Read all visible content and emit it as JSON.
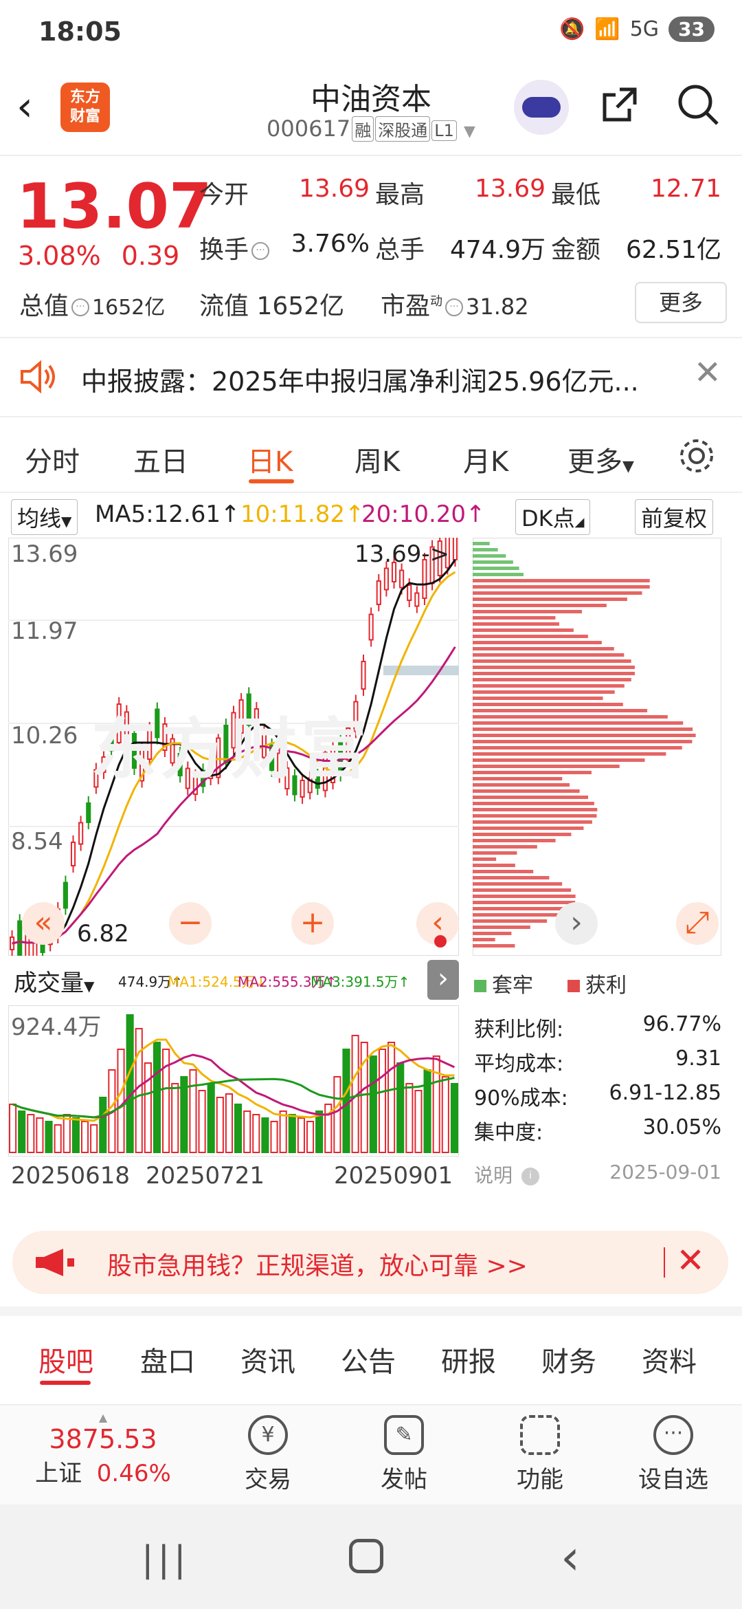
{
  "status": {
    "time": "18:05",
    "battery": "33",
    "signal": "5G"
  },
  "header": {
    "logo_line1": "东方",
    "logo_line2": "财富",
    "title": "中油资本",
    "code": "000617",
    "tags": [
      "融",
      "深股通",
      "L1"
    ]
  },
  "quote": {
    "price": "13.07",
    "pct": "3.08%",
    "change": "0.39",
    "open_label": "今开",
    "open": "13.69",
    "high_label": "最高",
    "high": "13.69",
    "low_label": "最低",
    "low": "12.71",
    "turnover_label": "换手",
    "turnover": "3.76%",
    "volume_label": "总手",
    "volume": "474.9万",
    "amount_label": "金额",
    "amount": "62.51亿",
    "mktcap_label": "总值",
    "mktcap": "1652亿",
    "float_label": "流值",
    "float": "1652亿",
    "pe_label": "市盈",
    "pe_sup": "动",
    "pe": "31.82",
    "more": "更多"
  },
  "notice": {
    "text": "中报披露：2025年中报归属净利润25.96亿元..."
  },
  "ktabs": [
    "分时",
    "五日",
    "日K",
    "周K",
    "月K",
    "更多"
  ],
  "ma": {
    "selector": "均线",
    "ma5": "MA5:12.61↑",
    "ma10": "10:11.82↑",
    "ma20": "20:10.20↑",
    "dk": "DK点",
    "adjust": "前复权"
  },
  "kchart": {
    "ylabels": [
      "13.69",
      "11.97",
      "10.26",
      "8.54",
      "6.82"
    ],
    "max_label": "13.69->",
    "min_label": "6.82",
    "watermark": "东方财富"
  },
  "volume": {
    "selector": "成交量",
    "vol": "474.9万↑",
    "ma1": "MA1:524.5万↓",
    "ma2": "MA2:555.3万↑",
    "ma3": "MA3:391.5万↑",
    "ylabel": "924.4万",
    "dates": [
      "20250618",
      "20250721",
      "20250901"
    ]
  },
  "chip": {
    "legend_trap": "套牢",
    "legend_profit": "获利",
    "stats": [
      {
        "label": "获利比例:",
        "value": "96.77%"
      },
      {
        "label": "平均成本:",
        "value": "9.31"
      },
      {
        "label": "90%成本:",
        "value": "6.91-12.85"
      },
      {
        "label": "集中度:",
        "value": "30.05%"
      }
    ],
    "explain": "说明",
    "date": "2025-09-01"
  },
  "ad": {
    "text": "股市急用钱？正规渠道，放心可靠 >>"
  },
  "btabs": [
    "股吧",
    "盘口",
    "资讯",
    "公告",
    "研报",
    "财务",
    "资料"
  ],
  "footer": {
    "index_value": "3875.53",
    "index_name": "上证",
    "index_pct": "0.46%",
    "items": [
      "交易",
      "发帖",
      "功能",
      "设自选"
    ]
  },
  "colors": {
    "up": "#e3272f",
    "down": "#1a9b1a",
    "accent": "#f05a22",
    "ma5": "#111111",
    "ma10": "#f0b400",
    "ma20": "#c0197a"
  }
}
